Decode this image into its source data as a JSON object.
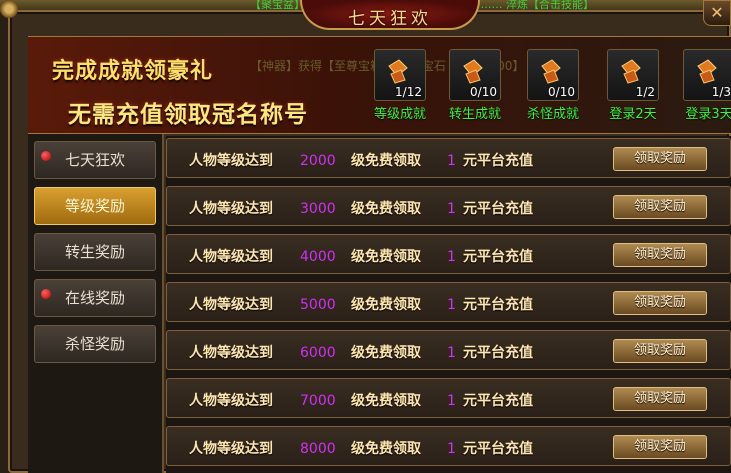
{
  "window": {
    "title": "七天狂欢",
    "close_glyph": "✕",
    "ticker": "【聚宝盆】  ……  【神器】获得了【极品装备】  ……  淬炼【合击技能】"
  },
  "banner": {
    "line1": "完成成就领豪礼",
    "line2": "无需充值领取冠名称号",
    "ghost_text": "【神器】获得【至尊宝箱】 精炼宝石【灵石7000】",
    "achievements": [
      {
        "count": "1/12",
        "label": "等级成就"
      },
      {
        "count": "0/10",
        "label": "转生成就"
      },
      {
        "count": "0/10",
        "label": "杀怪成就"
      },
      {
        "count": "1/2",
        "label": "登录2天"
      },
      {
        "count": "1/3",
        "label": "登录3天"
      }
    ]
  },
  "sidebar": {
    "items": [
      {
        "label": "七天狂欢",
        "dot": true,
        "active": false
      },
      {
        "label": "等级奖励",
        "dot": false,
        "active": true
      },
      {
        "label": "转生奖励",
        "dot": false,
        "active": false
      },
      {
        "label": "在线奖励",
        "dot": true,
        "active": false
      },
      {
        "label": "杀怪奖励",
        "dot": false,
        "active": false
      }
    ]
  },
  "rewards": {
    "prefix": "人物等级达到",
    "mid": "级免费领取",
    "suffix": "元平台充值",
    "button": "领取奖励",
    "rows": [
      {
        "level": "2000",
        "amount": "1"
      },
      {
        "level": "3000",
        "amount": "1"
      },
      {
        "level": "4000",
        "amount": "1"
      },
      {
        "level": "5000",
        "amount": "1"
      },
      {
        "level": "6000",
        "amount": "1"
      },
      {
        "level": "7000",
        "amount": "1"
      },
      {
        "level": "8000",
        "amount": "1"
      }
    ]
  },
  "colors": {
    "accent_gold": "#ffde6a",
    "achievement_green": "#3cf03c",
    "level_purple": "#d030f0",
    "active_tab": "#d8a030"
  }
}
